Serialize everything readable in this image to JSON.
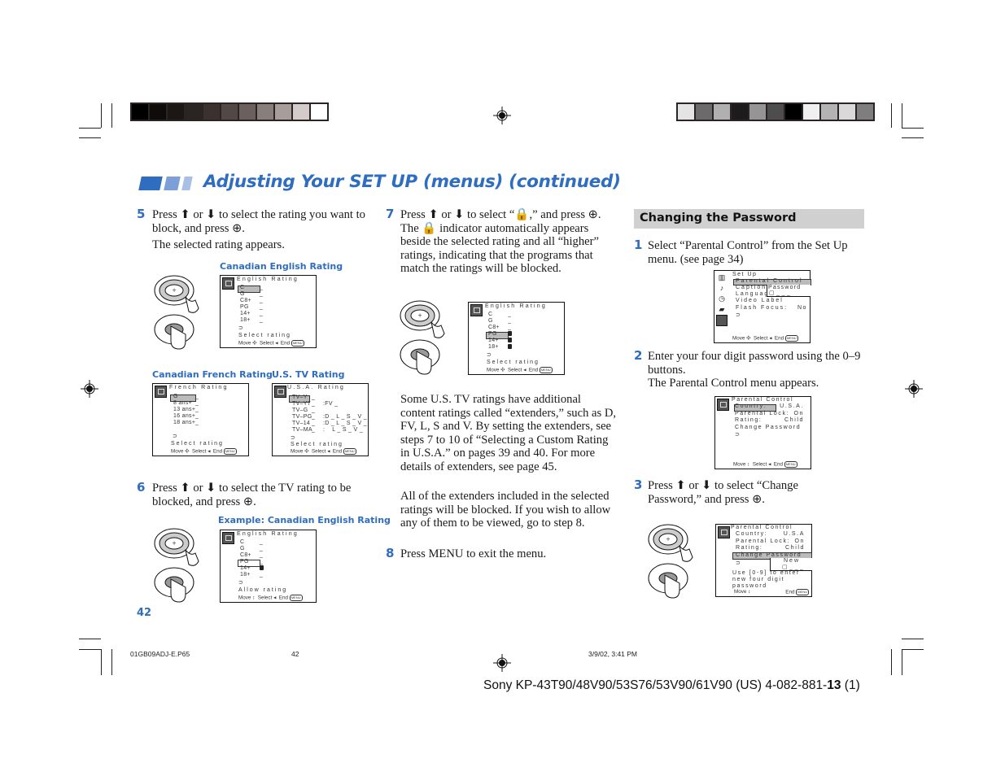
{
  "header": {
    "title": "Adjusting Your SET UP (menus) (continued)",
    "accent_color": "#2e6dbf",
    "left_swatches": [
      "#000000",
      "#0f0b0a",
      "#1c1715",
      "#2a2422",
      "#3b3230",
      "#524846",
      "#6b605d",
      "#887e7b",
      "#a79e9b",
      "#d4cccb",
      "#ffffff"
    ],
    "right_swatches": [
      "#e4e4e4",
      "#6b6b6b",
      "#b0b0b0",
      "#1c1c1c",
      "#959595",
      "#4d4d4d",
      "#000000",
      "#f0f0f0",
      "#b3b3b3",
      "#d9d9d9",
      "#7e7e7e"
    ]
  },
  "left_column": {
    "step5": {
      "number": "5",
      "text_a": "Press ⬆ or ⬇ to select the rating you want to block, and press ⊕.",
      "text_b": "The selected rating appears.",
      "caption_english": "Canadian English Rating",
      "osd_english": {
        "heading": "English Rating",
        "rows": [
          {
            "label": "C",
            "value": "_"
          },
          {
            "label": "G",
            "value": "_"
          },
          {
            "label": "C8+",
            "value": "_"
          },
          {
            "label": "PG",
            "value": "_"
          },
          {
            "label": "14+",
            "value": "_"
          },
          {
            "label": "18+",
            "value": "_"
          }
        ],
        "selected": "C",
        "status": "Select rating",
        "footer": {
          "move": "Move",
          "select": "Select",
          "end": "End",
          "menu": "MENU"
        }
      },
      "caption_french": "Canadian French Rating",
      "osd_french": {
        "heading": "French Rating",
        "rows": [
          {
            "label": "G",
            "value": "_"
          },
          {
            "label": "8 ans+",
            "value": "_"
          },
          {
            "label": "13 ans+",
            "value": "_"
          },
          {
            "label": "16 ans+",
            "value": "_"
          },
          {
            "label": "18 ans+",
            "value": "_"
          }
        ],
        "selected": "G",
        "status": "Select rating",
        "footer": {
          "move": "Move",
          "select": "Select",
          "end": "End",
          "menu": "MENU"
        }
      },
      "caption_us": "U.S. TV Rating",
      "osd_us": {
        "heading": "U.S.A. Rating",
        "rows": [
          {
            "label": "TV–Y",
            "value": "_",
            "ext": ""
          },
          {
            "label": "TV–Y7",
            "value": "_",
            "ext": ":FV _"
          },
          {
            "label": "TV–G",
            "value": "_",
            "ext": ""
          },
          {
            "label": "TV–PG",
            "value": "_",
            "ext": ":D _ L _ S _ V _"
          },
          {
            "label": "TV–14",
            "value": "_",
            "ext": ":D _ L _ S _ V _"
          },
          {
            "label": "TV–MA",
            "value": "_",
            "ext": ":    L _ S _ V _"
          }
        ],
        "selected": "TV–Y",
        "status": "Select rating",
        "footer": {
          "move": "Move",
          "select": "Select",
          "end": "End",
          "menu": "MENU"
        }
      }
    },
    "step6": {
      "number": "6",
      "text": "Press ⬆ or ⬇ to select the TV rating to be blocked, and press ⊕.",
      "caption": "Example: Canadian English Rating",
      "osd": {
        "heading": "English Rating",
        "rows": [
          {
            "label": "C",
            "value": "_"
          },
          {
            "label": "G",
            "value": "_"
          },
          {
            "label": "C8+",
            "value": "_"
          },
          {
            "label": "PG",
            "value": "_"
          },
          {
            "label": "14+",
            "value": "lock"
          },
          {
            "label": "18+",
            "value": "_"
          }
        ],
        "selected": "PG",
        "status": "Allow rating",
        "footer": {
          "move": "Move",
          "select": "Select",
          "end": "End",
          "menu": "MENU"
        }
      }
    },
    "page_number": "42"
  },
  "middle_column": {
    "step7": {
      "number": "7",
      "text": "Press ⬆ or ⬇ to select “🔒,” and press ⊕. The 🔒 indicator automatically appears beside the selected rating and all “higher” ratings, indicating that the programs that match the ratings will be blocked.",
      "osd": {
        "heading": "English Rating",
        "rows": [
          {
            "label": "C",
            "value": "_"
          },
          {
            "label": "G",
            "value": "_"
          },
          {
            "label": "C8+",
            "value": "_"
          },
          {
            "label": "PG",
            "value": "lock"
          },
          {
            "label": "14+",
            "value": "lock"
          },
          {
            "label": "18+",
            "value": "lock"
          }
        ],
        "selected": "PG",
        "status": "Select rating",
        "footer": {
          "move": "Move",
          "select": "Select",
          "end": "End",
          "menu": "MENU"
        }
      }
    },
    "para1": "Some U.S. TV ratings have additional content ratings called “extenders,” such as D, FV, L, S and V. By setting the extenders, see steps 7 to 10 of “Selecting a Custom Rating in U.S.A.” on pages 39 and 40. For more details of extenders, see page 45.",
    "para2": "All of the extenders included in the selected ratings will be blocked. If you wish to allow any of them to be viewed, go to step 8.",
    "step8": {
      "number": "8",
      "text": "Press MENU to exit the menu."
    }
  },
  "right_column": {
    "section_title": "Changing the Password",
    "step1": {
      "number": "1",
      "text": "Select “Parental Control” from the Set Up menu. (see page 34)",
      "osd": {
        "heading": "Set Up",
        "rows": [
          "Parental Control",
          "Caption Vi",
          "Language",
          "Video Label",
          "Flash Focus:"
        ],
        "flash_value": "No",
        "popup_label": "Password",
        "popup_value": "▢ _ _ _",
        "footer": {
          "move": "Move",
          "select": "Select",
          "end": "End",
          "menu": "MENU"
        }
      }
    },
    "step2": {
      "number": "2",
      "text_a": "Enter your four digit password using the 0–9 buttons.",
      "text_b": "The Parental Control menu appears.",
      "osd": {
        "heading": "Parental Control",
        "rows": [
          {
            "label": "Country:",
            "value": "U.S.A."
          },
          {
            "label": "Parental Lock:",
            "value": "On"
          },
          {
            "label": "Rating:",
            "value": "Child"
          },
          {
            "label": "Change Password",
            "value": ""
          }
        ],
        "selected": "Country:",
        "footer": {
          "move": "Move",
          "select": "Select",
          "end": "End",
          "menu": "MENU"
        }
      }
    },
    "step3": {
      "number": "3",
      "text": "Press ⬆ or ⬇ to select “Change Password,” and press ⊕.",
      "osd": {
        "heading": "Parental Control",
        "rows": [
          {
            "label": "Country:",
            "value": "U.S.A"
          },
          {
            "label": "Parental Lock:",
            "value": "On"
          },
          {
            "label": "Rating:",
            "value": "Child"
          },
          {
            "label": "Change Password",
            "value": ""
          }
        ],
        "selected": "Change Password",
        "popup_label": "New",
        "popup_value": "▢ _ _ _",
        "hint": [
          "Use [0-9] to enter",
          "new four digit",
          "password"
        ],
        "footer": {
          "move": "Move",
          "end": "End",
          "menu": "MENU"
        }
      }
    }
  },
  "slug": {
    "file": "01GB09ADJ-E.P65",
    "page": "42",
    "date": "3/9/02, 3:41 PM"
  },
  "footer": {
    "model_prefix": "Sony KP-43T90/48V90/53S76/53V90/61V90 (US) 4-082-881-",
    "model_bold": "13",
    "model_suffix": " (1)"
  }
}
